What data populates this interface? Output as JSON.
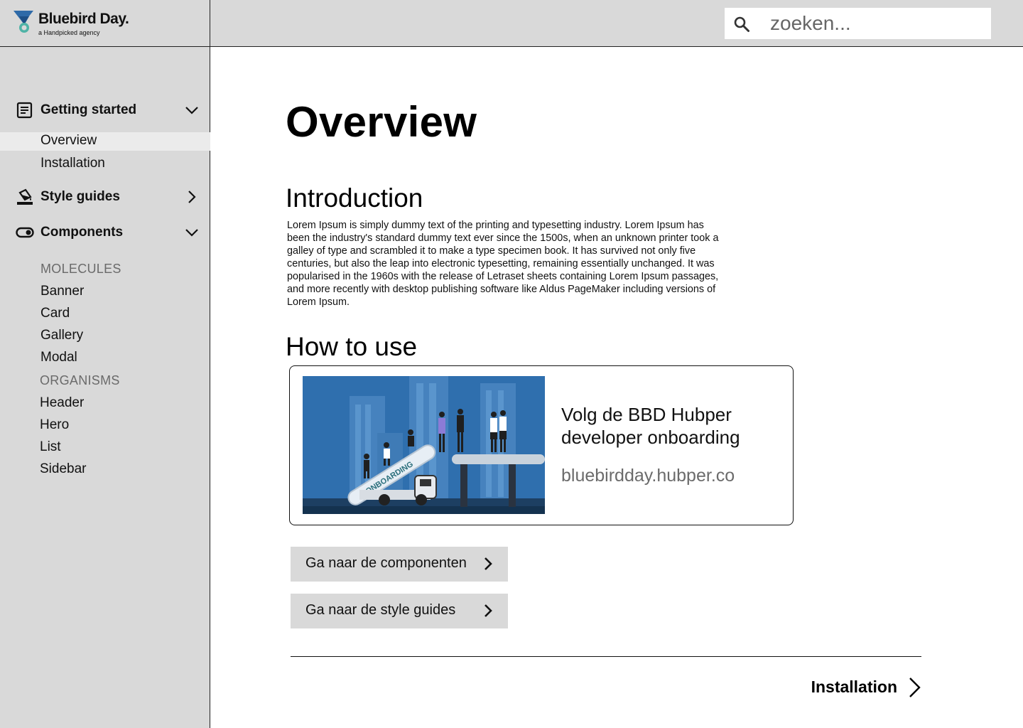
{
  "brand": {
    "name": "Bluebird Day.",
    "tagline": "a Handpicked agency",
    "primary_color": "#2e6aa8",
    "accent_color": "#4fb3a6"
  },
  "search": {
    "placeholder": "zoeken...",
    "icon": "search-icon"
  },
  "sidebar": {
    "sections": [
      {
        "label": "Getting started",
        "icon": "document-icon",
        "expanded": true,
        "items": [
          {
            "label": "Overview",
            "active": true
          },
          {
            "label": "Installation",
            "active": false
          }
        ]
      },
      {
        "label": "Style guides",
        "icon": "paint-bucket-icon",
        "expanded": false,
        "items": []
      },
      {
        "label": "Components",
        "icon": "toggle-icon",
        "expanded": true,
        "groups": [
          {
            "label": "MOLECULES",
            "items": [
              "Banner",
              "Card",
              "Gallery",
              "Modal"
            ]
          },
          {
            "label": "ORGANISMS",
            "items": [
              "Header",
              "Hero",
              "List",
              "Sidebar"
            ]
          }
        ]
      }
    ]
  },
  "main": {
    "title": "Overview",
    "intro": {
      "heading": "Introduction",
      "body": "Lorem Ipsum is simply dummy text of the printing and typesetting industry. Lorem Ipsum has been the industry's standard dummy text ever since the 1500s, when an unknown printer took a galley of type and scrambled it to make a type specimen book. It has survived not only five centuries, but also the leap into electronic typesetting, remaining essentially unchanged. It was popularised in the 1960s with the release of Letraset sheets containing Lorem Ipsum passages, and more recently with desktop publishing software like Aldus PageMaker including versions of Lorem Ipsum."
    },
    "how_to_use": {
      "heading": "How to use",
      "card": {
        "title": "Volg de BBD Hubper developer onboarding",
        "url": "bluebirdday.hubper.co",
        "image_label": "ONBOARDING"
      },
      "buttons": [
        {
          "label": "Ga naar de componenten"
        },
        {
          "label": "Ga naar de style guides"
        }
      ]
    },
    "next_page": {
      "label": "Installation"
    }
  }
}
